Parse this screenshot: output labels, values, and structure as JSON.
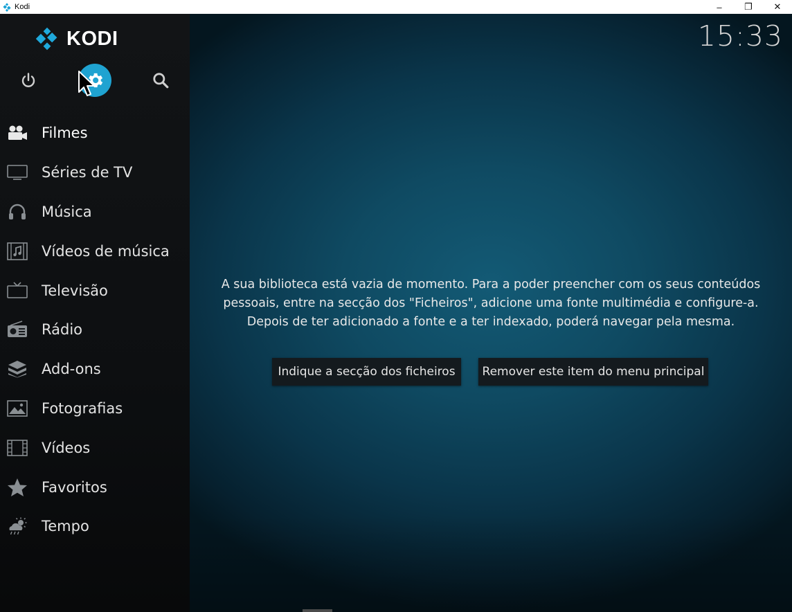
{
  "window": {
    "title": "Kodi",
    "minimize_glyph": "–",
    "restore_glyph": "❐",
    "close_glyph": "✕"
  },
  "logo": {
    "text": "KODI",
    "icon": "kodi-logo-icon"
  },
  "top_icons": [
    {
      "name": "power-icon"
    },
    {
      "name": "settings-icon",
      "active": true
    },
    {
      "name": "search-icon"
    }
  ],
  "clock": "15:33",
  "menu": {
    "items": [
      {
        "label": "Filmes",
        "icon": "movies-icon"
      },
      {
        "label": "Séries de TV",
        "icon": "tv-shows-icon"
      },
      {
        "label": "Música",
        "icon": "headphones-icon"
      },
      {
        "label": "Vídeos de música",
        "icon": "music-videos-icon"
      },
      {
        "label": "Televisão",
        "icon": "television-icon"
      },
      {
        "label": "Rádio",
        "icon": "radio-icon"
      },
      {
        "label": "Add-ons",
        "icon": "addons-icon"
      },
      {
        "label": "Fotografias",
        "icon": "pictures-icon"
      },
      {
        "label": "Vídeos",
        "icon": "videos-icon"
      },
      {
        "label": "Favoritos",
        "icon": "star-icon"
      },
      {
        "label": "Tempo",
        "icon": "weather-icon"
      }
    ]
  },
  "main": {
    "message": "A sua biblioteca está vazia de momento. Para a poder preencher com os seus conteúdos pessoais, entre na secção dos \"Ficheiros\", adicione uma fonte multimédia e configure-a. Depois de ter adicionado a fonte e a ter indexado, poderá navegar pela mesma.",
    "button_files": "Indique a secção dos ficheiros",
    "button_remove": "Remover este item do menu principal"
  },
  "colors": {
    "accent": "#1fa3d1",
    "sidebar": "#121416",
    "background": "#0f4a62"
  }
}
